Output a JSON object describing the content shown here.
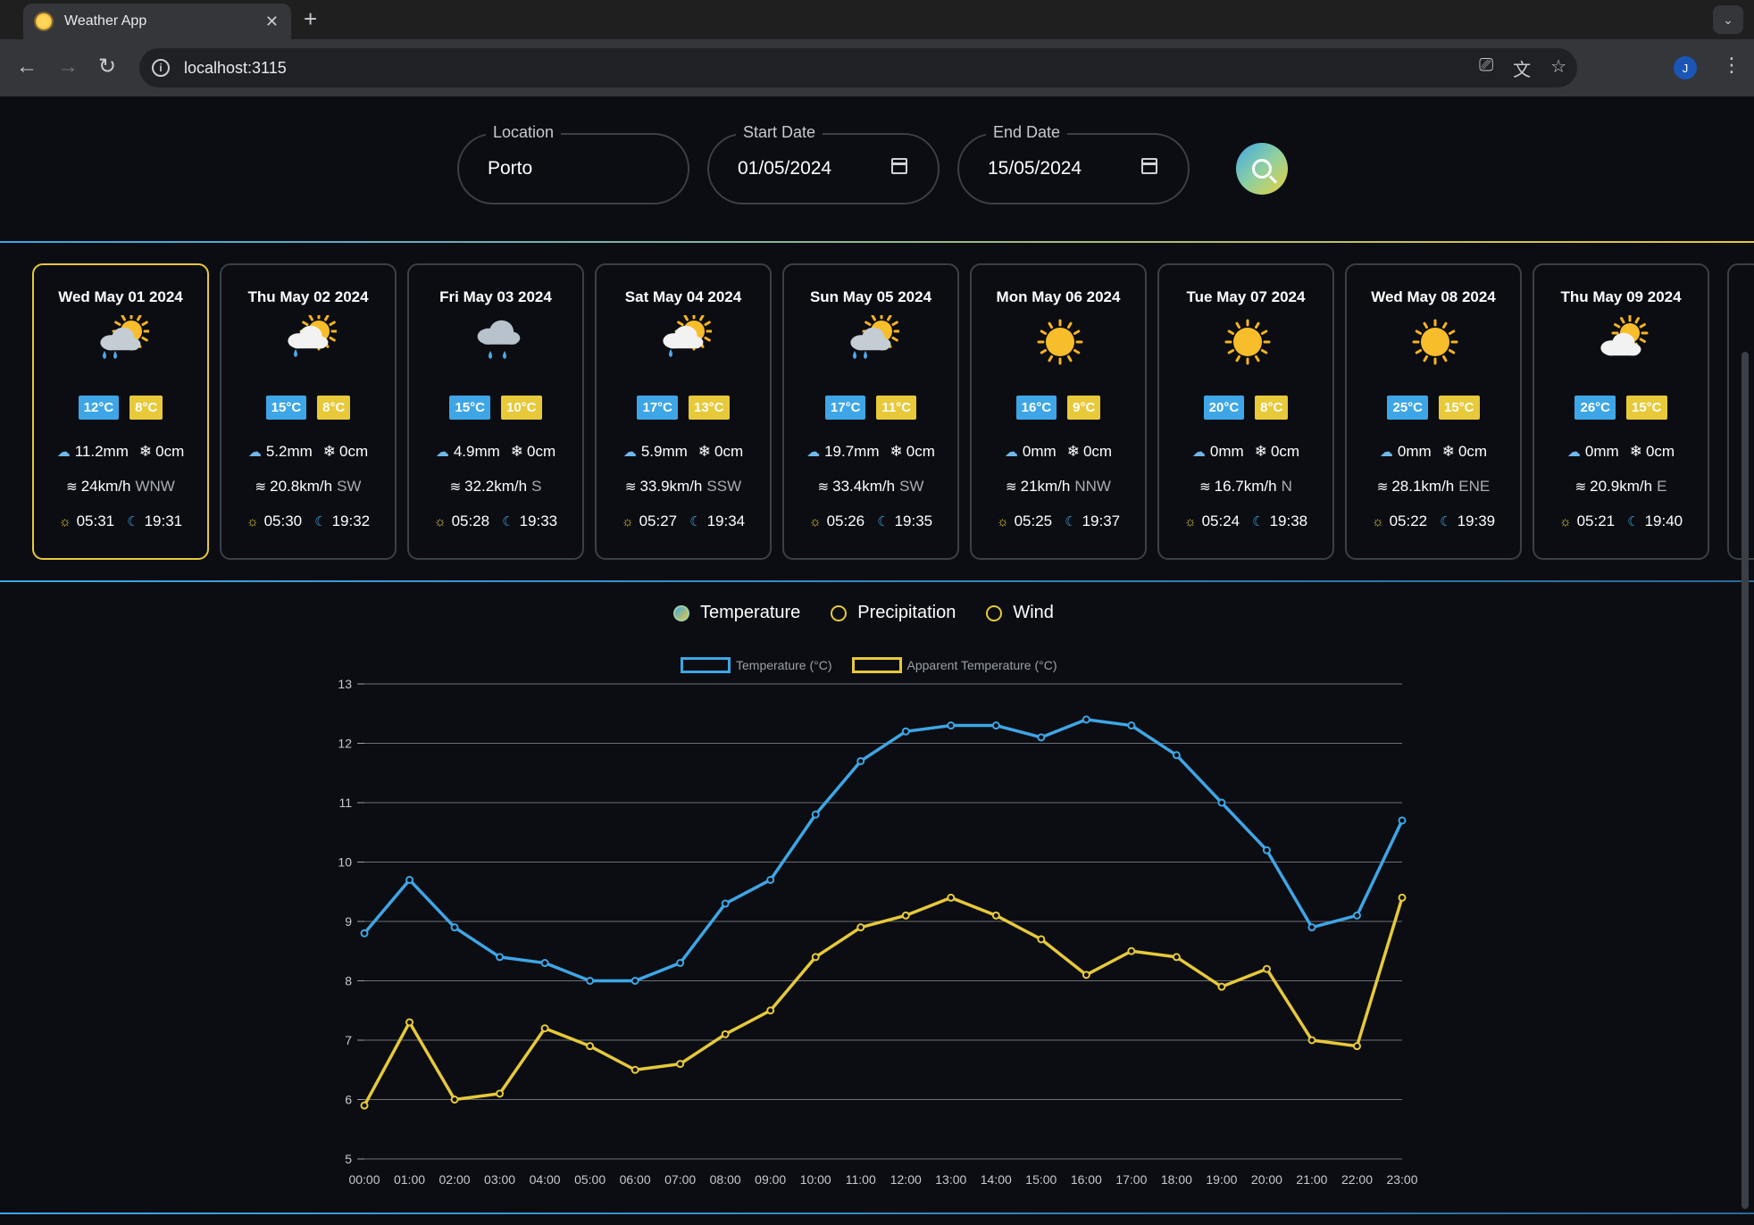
{
  "browser": {
    "tab_title": "Weather App",
    "url": "localhost:3115",
    "avatar_letter": "J"
  },
  "search": {
    "location_label": "Location",
    "location_value": "Porto",
    "start_label": "Start Date",
    "start_value": "01/05/2024",
    "end_label": "End Date",
    "end_value": "15/05/2024"
  },
  "days": [
    {
      "date": "Wed May 01 2024",
      "icon": "partly-cloudy-rain-icon",
      "max": "12°C",
      "min": "8°C",
      "rain": "11.2mm",
      "snow": "0cm",
      "wind": "24km/h",
      "dir": "WNW",
      "sunrise": "05:31",
      "sunset": "19:31"
    },
    {
      "date": "Thu May 02 2024",
      "icon": "partly-cloudy-drizzle-icon",
      "max": "15°C",
      "min": "8°C",
      "rain": "5.2mm",
      "snow": "0cm",
      "wind": "20.8km/h",
      "dir": "SW",
      "sunrise": "05:30",
      "sunset": "19:32"
    },
    {
      "date": "Fri May 03 2024",
      "icon": "rain-cloud-icon",
      "max": "15°C",
      "min": "10°C",
      "rain": "4.9mm",
      "snow": "0cm",
      "wind": "32.2km/h",
      "dir": "S",
      "sunrise": "05:28",
      "sunset": "19:33"
    },
    {
      "date": "Sat May 04 2024",
      "icon": "partly-cloudy-drizzle-icon",
      "max": "17°C",
      "min": "13°C",
      "rain": "5.9mm",
      "snow": "0cm",
      "wind": "33.9km/h",
      "dir": "SSW",
      "sunrise": "05:27",
      "sunset": "19:34"
    },
    {
      "date": "Sun May 05 2024",
      "icon": "partly-cloudy-rain-icon",
      "max": "17°C",
      "min": "11°C",
      "rain": "19.7mm",
      "snow": "0cm",
      "wind": "33.4km/h",
      "dir": "SW",
      "sunrise": "05:26",
      "sunset": "19:35"
    },
    {
      "date": "Mon May 06 2024",
      "icon": "sun-icon",
      "max": "16°C",
      "min": "9°C",
      "rain": "0mm",
      "snow": "0cm",
      "wind": "21km/h",
      "dir": "NNW",
      "sunrise": "05:25",
      "sunset": "19:37"
    },
    {
      "date": "Tue May 07 2024",
      "icon": "sun-icon",
      "max": "20°C",
      "min": "8°C",
      "rain": "0mm",
      "snow": "0cm",
      "wind": "16.7km/h",
      "dir": "N",
      "sunrise": "05:24",
      "sunset": "19:38"
    },
    {
      "date": "Wed May 08 2024",
      "icon": "sun-icon",
      "max": "25°C",
      "min": "15°C",
      "rain": "0mm",
      "snow": "0cm",
      "wind": "28.1km/h",
      "dir": "ENE",
      "sunrise": "05:22",
      "sunset": "19:39"
    },
    {
      "date": "Thu May 09 2024",
      "icon": "sun-behind-cloud-icon",
      "max": "26°C",
      "min": "15°C",
      "rain": "0mm",
      "snow": "0cm",
      "wind": "20.9km/h",
      "dir": "E",
      "sunrise": "05:21",
      "sunset": "19:40"
    }
  ],
  "chart_toggle": {
    "options": [
      "Temperature",
      "Precipitation",
      "Wind"
    ],
    "selected": "Temperature"
  },
  "colors": {
    "blue": "#3ea6e6",
    "yellow": "#e7c93a",
    "background": "#0b0d12"
  },
  "chart_data": {
    "type": "line",
    "title": "",
    "xlabel": "",
    "ylabel": "",
    "x": [
      "00:00",
      "01:00",
      "02:00",
      "03:00",
      "04:00",
      "05:00",
      "06:00",
      "07:00",
      "08:00",
      "09:00",
      "10:00",
      "11:00",
      "12:00",
      "13:00",
      "14:00",
      "15:00",
      "16:00",
      "17:00",
      "18:00",
      "19:00",
      "20:00",
      "21:00",
      "22:00",
      "23:00"
    ],
    "ylim": [
      5,
      13
    ],
    "yticks": [
      5,
      6,
      7,
      8,
      9,
      10,
      11,
      12,
      13
    ],
    "grid": true,
    "legend_position": "top",
    "series": [
      {
        "name": "Temperature (°C)",
        "color": "#3ea6e6",
        "values": [
          8.8,
          9.7,
          8.9,
          8.4,
          8.3,
          8.0,
          8.0,
          8.3,
          9.3,
          9.7,
          10.8,
          11.7,
          12.2,
          12.3,
          12.3,
          12.1,
          12.4,
          12.3,
          11.8,
          11.0,
          10.2,
          8.9,
          9.1,
          10.7
        ]
      },
      {
        "name": "Apparent Temperature (°C)",
        "color": "#e7c93a",
        "values": [
          5.9,
          7.3,
          6.0,
          6.1,
          7.2,
          6.9,
          6.5,
          6.6,
          7.1,
          7.5,
          8.4,
          8.9,
          9.1,
          9.4,
          9.1,
          8.7,
          8.1,
          8.5,
          8.4,
          7.9,
          8.2,
          7.0,
          6.9,
          9.4
        ]
      }
    ]
  }
}
